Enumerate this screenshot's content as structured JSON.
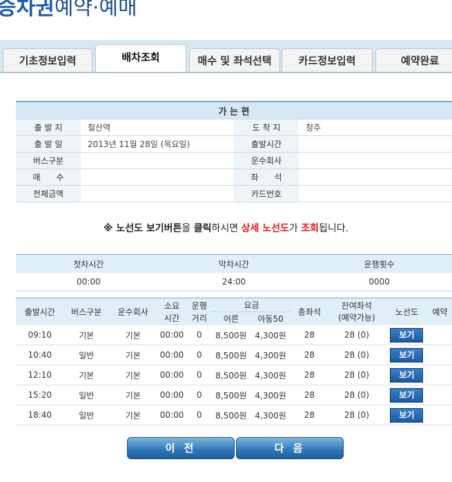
{
  "page_title_strong": "승차권",
  "page_title_rest": "예약·예매",
  "tabs": [
    {
      "label": "기초정보입력"
    },
    {
      "label": "배차조회"
    },
    {
      "label": "매수 및 좌석선택"
    },
    {
      "label": "카드정보입력"
    },
    {
      "label": "예약완료"
    }
  ],
  "info": {
    "header": "가 는 편",
    "labels": {
      "origin": "출 발 지",
      "destination": "도 착 지",
      "date": "출 발 일",
      "dep_time": "출발시간",
      "bus_type": "버스구분",
      "company": "운수회사",
      "count": "매      수",
      "seat": "좌      석",
      "total": "전체금액",
      "card": "카드번호"
    },
    "values": {
      "origin": "철산역",
      "destination": "청주",
      "date": "2013년 11월 28일 (목요일)",
      "dep_time": "",
      "bus_type": "",
      "company": "",
      "count": "",
      "seat": "",
      "total": "",
      "card": ""
    }
  },
  "notice": {
    "prefix": "※ 노선도 보기버튼",
    "p1": "을 ",
    "click": "클릭",
    "p2": "하시면 ",
    "detail": "상세 노선도",
    "p3": "가 ",
    "inquiry": "조회",
    "suffix": "됩니다."
  },
  "summary": {
    "headers": [
      "첫차시간",
      "막차시간",
      "운행횟수"
    ],
    "values": [
      "00:00",
      "24:00",
      "0000"
    ]
  },
  "schedule": {
    "headers": {
      "dep": "출발시간",
      "bus": "버스구분",
      "company": "운수회사",
      "duration": "소요\n시간",
      "distance": "운행\n거리",
      "fare": "요금",
      "adult": "어른",
      "child": "아동50",
      "total_seats": "총좌석",
      "remaining": "잔여좌석\n(예약가능)",
      "route": "노선도",
      "reserve": "예약"
    },
    "rows": [
      {
        "dep": "09:10",
        "bus": "기본",
        "company": "기본",
        "duration": "00:00",
        "distance": "0",
        "adult": "8,500원",
        "child": "4,300원",
        "total": "28",
        "remain": "28 (0)",
        "btn": "보기"
      },
      {
        "dep": "10:40",
        "bus": "일반",
        "company": "기본",
        "duration": "00:00",
        "distance": "0",
        "adult": "8,500원",
        "child": "4,300원",
        "total": "28",
        "remain": "28 (0)",
        "btn": "보기"
      },
      {
        "dep": "12:10",
        "bus": "기본",
        "company": "기본",
        "duration": "00:00",
        "distance": "0",
        "adult": "8,500원",
        "child": "4,300원",
        "total": "28",
        "remain": "28 (0)",
        "btn": "보기"
      },
      {
        "dep": "15:20",
        "bus": "일반",
        "company": "기본",
        "duration": "00:00",
        "distance": "0",
        "adult": "8,500원",
        "child": "4,300원",
        "total": "28",
        "remain": "28 (0)",
        "btn": "보기"
      },
      {
        "dep": "18:40",
        "bus": "일반",
        "company": "기본",
        "duration": "00:00",
        "distance": "0",
        "adult": "8,500원",
        "child": "4,300원",
        "total": "28",
        "remain": "28 (0)",
        "btn": "보기"
      }
    ]
  },
  "buttons": {
    "prev": "이 전",
    "next": "다 음"
  }
}
